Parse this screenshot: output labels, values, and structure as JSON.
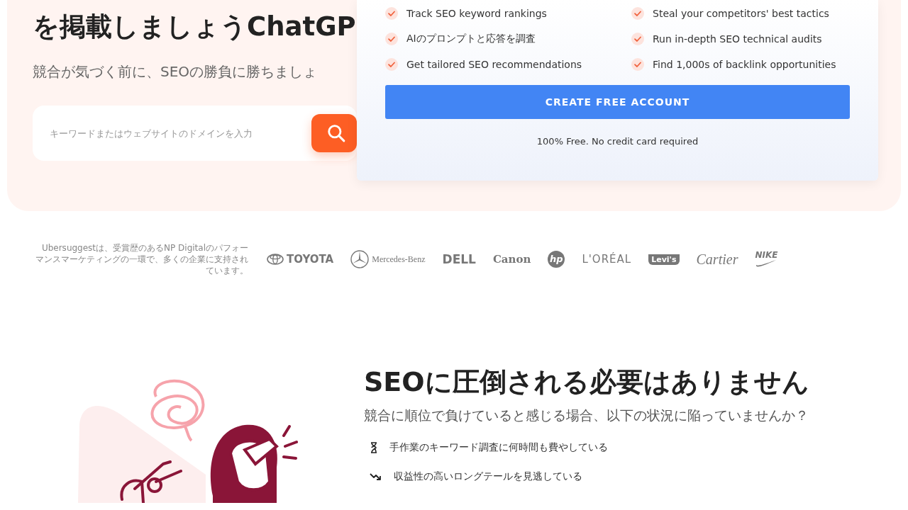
{
  "hero": {
    "heading": "を掲載しましょうChatGP",
    "subtitle": "競合が気づく前に、SEOの勝負に勝ちましょ",
    "search": {
      "placeholder": "キーワードまたはウェブサイトのドメインを入力"
    }
  },
  "signup_card": {
    "features": [
      "Track SEO keyword rankings",
      "Steal your competitors' best tactics",
      "AIのプロンプトと応答を調査",
      "Run in-depth SEO technical audits",
      "Get tailored SEO recommendations",
      "Find 1,000s of backlink opportunities"
    ],
    "button": "CREATE FREE ACCOUNT",
    "note": "100% Free. No credit card required"
  },
  "trust": {
    "text": "Ubersuggestは、受賞歴のあるNP Digitalのパフォーマンスマーケティングの一環で、多くの企業に支持されています。",
    "logos": [
      {
        "kind": "toyota",
        "text": "TOYOTA"
      },
      {
        "kind": "mercedes",
        "text": "Mercedes-Benz"
      },
      {
        "kind": "dell",
        "text": "DELL"
      },
      {
        "kind": "canon",
        "text": "Canon"
      },
      {
        "kind": "hp",
        "text": "hp"
      },
      {
        "kind": "loreal",
        "text": "L'ORÉAL"
      },
      {
        "kind": "levis",
        "text": "Levi's"
      },
      {
        "kind": "cartier",
        "text": "Cartier"
      },
      {
        "kind": "nike",
        "text": "NIKE"
      }
    ]
  },
  "problem": {
    "heading": "SEOに圧倒される必要はありません",
    "subtitle": "競合に順位で負けていると感じる場合、以下の状況に陥っていませんか？",
    "items": [
      {
        "kind": "hourglass",
        "text": "手作業のキーワード調査に何時間も費やしている"
      },
      {
        "kind": "trend-down",
        "text": "収益性の高いロングテールを見逃している"
      }
    ]
  }
}
